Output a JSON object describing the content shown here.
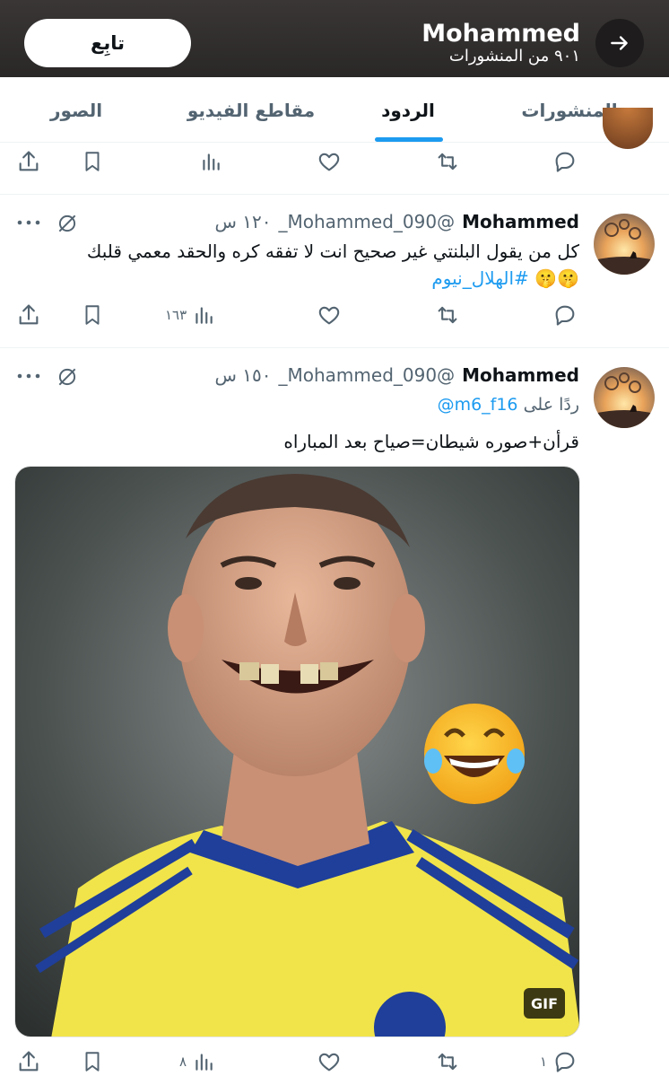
{
  "header": {
    "title": "Mohammed",
    "subtitle": "٩٠١ من المنشورات",
    "follow_label": "تابِع"
  },
  "tabs": [
    {
      "label": "المنشورات",
      "active": false
    },
    {
      "label": "الردود",
      "active": true
    },
    {
      "label": "مقاطع الفيديو",
      "active": false
    },
    {
      "label": "الصور",
      "active": false
    }
  ],
  "tweets": [
    {
      "author": "Mohammed",
      "handle": "_Mohammed_090@",
      "time": "١٢٠ س",
      "text": "كل من يقول البلنتي غير صحيح انت لا تفقه كره والحقد معمي قلبك",
      "hashtag": "#الهلال_نيوم",
      "emoji": "🤫🤫",
      "views": "١٦٣"
    },
    {
      "author": "Mohammed",
      "handle": "_Mohammed_090@",
      "time": "١٥٠ س",
      "reply_prefix": "ردًا على",
      "reply_to": "@m6_f16",
      "text": "قرأن+صوره شيطان=صياح بعد المباراه",
      "media_badge": "GIF",
      "replies": "١",
      "views": "٨"
    }
  ],
  "colors": {
    "accent": "#1d9bf0",
    "header_bg": "#2f2c2c",
    "text_secondary": "#536471"
  }
}
